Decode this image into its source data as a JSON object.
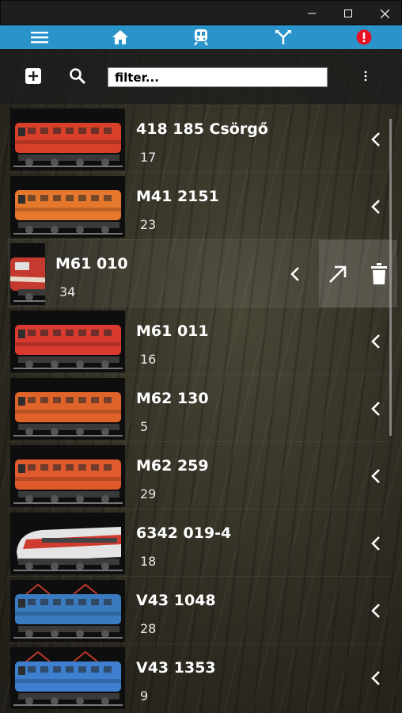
{
  "nav": {
    "items": [
      {
        "name": "menu",
        "icon": "hamburger-menu-icon"
      },
      {
        "name": "home",
        "icon": "home-icon"
      },
      {
        "name": "locomotives",
        "icon": "train-icon"
      },
      {
        "name": "switches",
        "icon": "track-switch-icon"
      },
      {
        "name": "alert",
        "icon": "alert-icon"
      }
    ],
    "accent": "#2a93c9",
    "alert_color": "#e81123"
  },
  "toolbar": {
    "filter_placeholder": "filter...",
    "add_icon": "add-icon",
    "search_icon": "search-icon",
    "more_icon": "more-vertical-icon"
  },
  "locomotives": [
    {
      "name": "418 185 Csörgő",
      "count": "17",
      "color": "#d8402a"
    },
    {
      "name": "M41 2151",
      "count": "23",
      "color": "#e5782c"
    },
    {
      "name": "M61 010",
      "count": "34",
      "color": "#c43a2e"
    },
    {
      "name": "M61 011",
      "count": "16",
      "color": "#d83a30"
    },
    {
      "name": "M62 130",
      "count": "5",
      "color": "#e0642a"
    },
    {
      "name": "M62 259",
      "count": "29",
      "color": "#e05a2e"
    },
    {
      "name": "6342 019-4",
      "count": "18",
      "color": "#d8d8d8"
    },
    {
      "name": "V43 1048",
      "count": "28",
      "color": "#3a7bbf"
    },
    {
      "name": "V43 1353",
      "count": "9",
      "color": "#3e7fd0"
    }
  ]
}
